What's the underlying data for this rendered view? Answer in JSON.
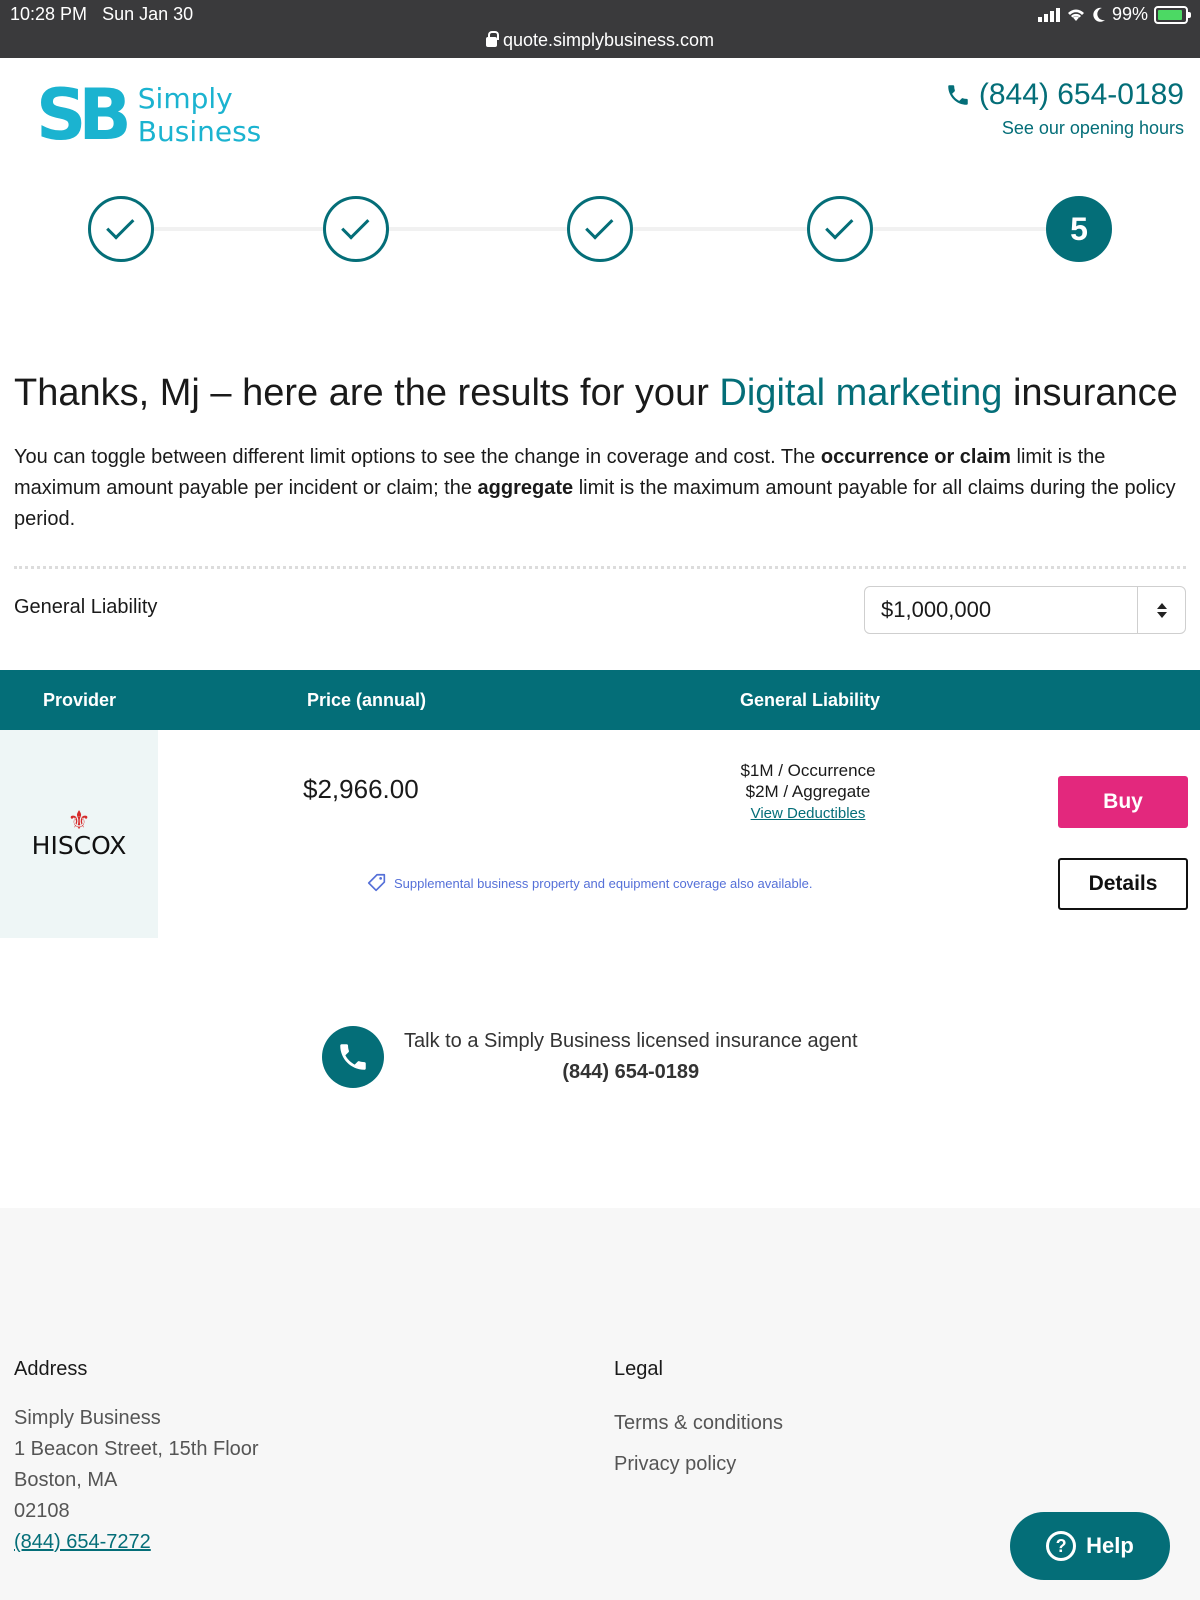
{
  "status_bar": {
    "time": "10:28 PM",
    "date": "Sun Jan 30",
    "battery": "99%",
    "url": "quote.simplybusiness.com"
  },
  "header": {
    "logo_mark": "SB",
    "logo_line1": "Simply",
    "logo_line2": "Business",
    "phone": "(844) 654-0189",
    "hours_link": "See our opening hours"
  },
  "stepper": {
    "completed_steps": 4,
    "current_step": "5"
  },
  "page": {
    "title_prefix": "Thanks, Mj – here are the results for your ",
    "title_accent": "Digital marketing",
    "title_suffix": " insurance",
    "intro_1": "You can toggle between different limit options to see the change in coverage and cost. The ",
    "intro_bold_1": "occurrence or claim",
    "intro_2": " limit is the maximum amount payable per incident or claim; the ",
    "intro_bold_2": "aggregate",
    "intro_3": " limit is the maximum amount payable for all claims during the policy period."
  },
  "limit_selector": {
    "label": "General Liability",
    "selected": "$1,000,000"
  },
  "table": {
    "headers": {
      "provider": "Provider",
      "price": "Price (annual)",
      "liability": "General Liability"
    },
    "rows": [
      {
        "provider": "HISCOX",
        "price": "$2,966.00",
        "occurrence": "$1M / Occurrence",
        "aggregate": "$2M / Aggregate",
        "deductibles_link": "View Deductibles",
        "note": "Supplemental business property and equipment coverage also available.",
        "buy_label": "Buy",
        "details_label": "Details"
      }
    ]
  },
  "agent": {
    "text": "Talk to a Simply Business licensed insurance agent",
    "phone": "(844) 654-0189"
  },
  "footer": {
    "address": {
      "heading": "Address",
      "line1": "Simply Business",
      "line2": "1 Beacon Street, 15th Floor",
      "line3": "Boston, MA",
      "line4": "02108",
      "phone": "(844) 654-7272"
    },
    "legal": {
      "heading": "Legal",
      "terms": "Terms & conditions",
      "privacy": "Privacy policy"
    }
  },
  "help_button": {
    "label": "Help"
  },
  "colors": {
    "brand_teal": "#046e78",
    "logo_cyan": "#1bb3d0",
    "buy_pink": "#e3287d",
    "note_blue": "#5570d8"
  }
}
